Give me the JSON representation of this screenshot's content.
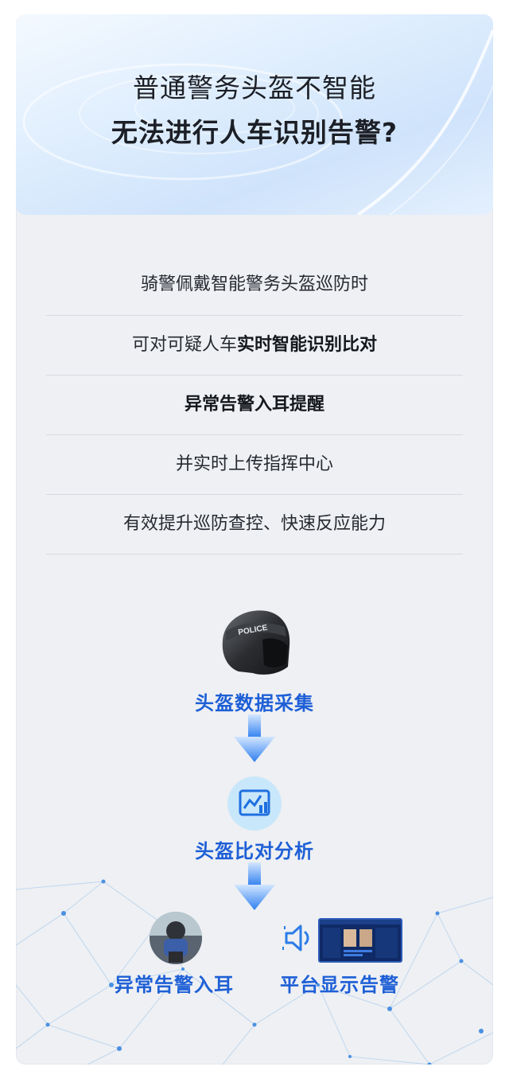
{
  "header": {
    "line1": "普通警务头盔不智能",
    "line2": "无法进行人车识别告警?"
  },
  "features": [
    {
      "plain": "骑警佩戴智能警务头盔巡防时",
      "bold": ""
    },
    {
      "plain": "可对可疑人车",
      "bold": "实时智能识别比对"
    },
    {
      "plain": "",
      "bold": "异常告警入耳提醒"
    },
    {
      "plain": "并实时上传指挥中心",
      "bold": ""
    },
    {
      "plain": "有效提升巡防查控、快速反应能力",
      "bold": ""
    }
  ],
  "helmet": {
    "visor_text": "POLICE"
  },
  "flow": {
    "step1": "头盔数据采集",
    "step2": "头盔比对分析",
    "out_left": "异常告警入耳",
    "out_right": "平台显示告警"
  },
  "icons": {
    "step2": "chart-analysis-icon",
    "speaker": "speaker-sound-icon"
  },
  "colors": {
    "accent": "#1e5fd6",
    "arrow": "#3b8cf5",
    "background": "#eef0f3"
  }
}
